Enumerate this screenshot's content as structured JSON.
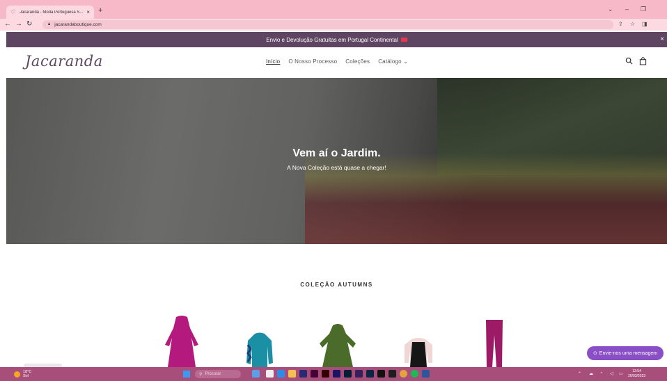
{
  "browser": {
    "tab_title": "Jacarandá - Moda Portuguesa S...",
    "tab_close": "×",
    "new_tab": "+",
    "url": "jacarandaboutique.com"
  },
  "announcement": {
    "text": "Envio e Devolução Gratuitas em Portugal Continental",
    "close": "×"
  },
  "header": {
    "logo": "Jacaranda",
    "menu": [
      {
        "label": "Início"
      },
      {
        "label": "O Nosso Processo"
      },
      {
        "label": "Coleções"
      },
      {
        "label": "Catálogo ⌄"
      }
    ]
  },
  "hero": {
    "title": "Vem aí o Jardim.",
    "subtitle": "A Nova Coleção está quase a chegar!"
  },
  "collection": {
    "title": "COLEÇÃO AUTUMNS"
  },
  "chat": {
    "label": "Envie-nos uma mensagem"
  },
  "taskbar": {
    "weather_temp": "18°C",
    "weather_desc": "Sol",
    "search": "Procurar",
    "time": "13:54",
    "date": "20/03/2023"
  },
  "colors": {
    "brand_purple": "#5e4561",
    "chat_purple": "#8a4fc7",
    "taskbar": "#a84e7a"
  }
}
